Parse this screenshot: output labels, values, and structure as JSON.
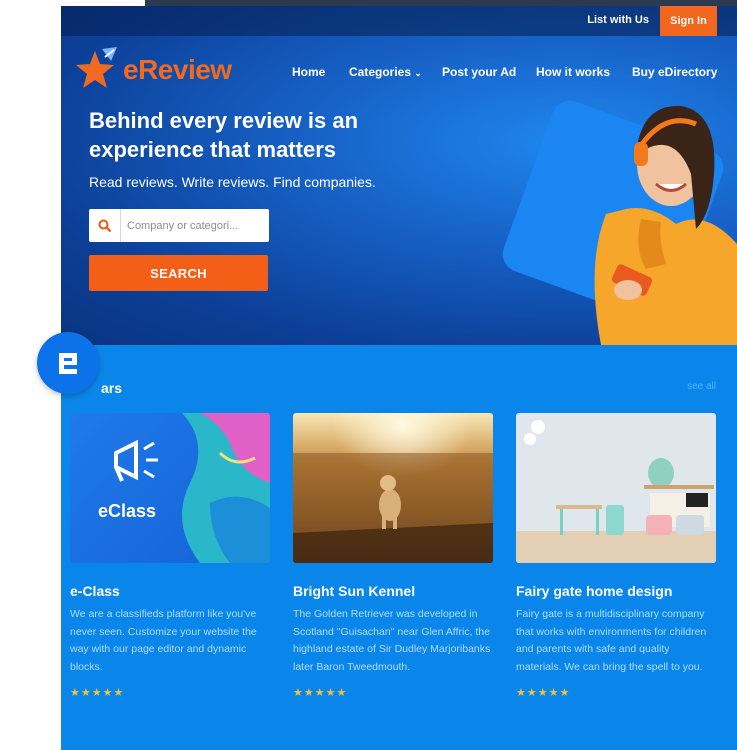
{
  "topbar": {
    "list_link": "List with Us",
    "signin": "Sign In"
  },
  "brand": {
    "logo_text": "eReview"
  },
  "nav": [
    {
      "label": "Home"
    },
    {
      "label": "Categories"
    },
    {
      "label": "Post your Ad"
    },
    {
      "label": "How it works"
    },
    {
      "label": "Buy eDirectory"
    }
  ],
  "hero": {
    "title": "Behind every review is an experience that matters",
    "subtitle": "Read reviews. Write reviews. Find companies.",
    "search_placeholder": "Company or categori...",
    "search_button": "SEARCH"
  },
  "section": {
    "title": "ars",
    "see_all": "see all"
  },
  "cards": [
    {
      "image_label": "eClass",
      "title": "e-Class",
      "description": "We are a classifieds platform like you've never seen. Customize your website the way with our page editor and dynamic blocks.",
      "stars": "★★★★★"
    },
    {
      "title": "Bright Sun Kennel",
      "description": "The Golden Retriever was developed in Scotland \"Guisachan\" near Glen Affric, the highland estate of Sir Dudley Marjoribanks later Baron Tweedmouth.",
      "stars": "★★★★★"
    },
    {
      "title": "Fairy gate home design",
      "description": "Fairy gate is a multidisciplinary company that works with environments for children and parents with safe and quality materials. We can bring the spell to you.",
      "stars": "★★★★★"
    }
  ],
  "colors": {
    "accent": "#f35f16",
    "primary": "#0a86ea",
    "hero_dark": "#0a3580",
    "star": "#f3c13a"
  }
}
